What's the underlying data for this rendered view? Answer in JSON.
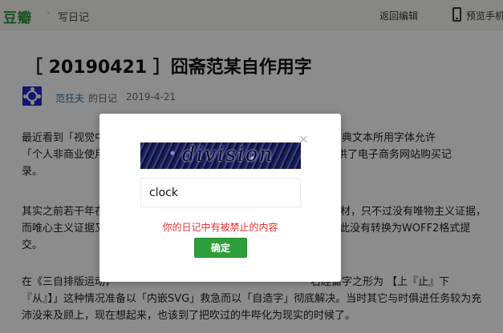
{
  "header": {
    "logo": "豆瓣",
    "separator": "·",
    "title": "写日记",
    "back_label": "返回编辑",
    "preview_label": "预览手机"
  },
  "article": {
    "title": "［ 20190421 ］囧斋范某自作用字",
    "author": "范狂夫",
    "diary_label": "的日记",
    "date": "2019-4-21",
    "paragraphs": [
      [
        "最近看到「视觉中",
        "",
        "附上。古典文本所用字体允许"
      ],
      [
        "「个人非商业使用",
        "",
        "字体则提供了电子商务网站购买记"
      ],
      [
        "录。"
      ],
      [
        "其实之前若干年在",
        "",
        "素材，只不过没有唯物主义证据，"
      ],
      [
        "而唯心主义证据又",
        "",
        "因此没有转换为WOFF2格式提"
      ],
      [
        "交。"
      ],
      [
        "在《三自排版运动，",
        "",
        "右經龠字之形为 【上『止』下"
      ],
      [
        "『从』】」这种情况准备以「内嵌SVG」救急而以「自造字」彻底解决。当时其它与时俱进任务较为充"
      ],
      [
        "沛没来及顾上，现在想起来，也该到了把吹过的牛哔化为现实的时候了。"
      ]
    ]
  },
  "dialog": {
    "captcha_text": "division",
    "input_value": "clock",
    "error": "你的日记中有被禁止的内容",
    "confirm_label": "确定",
    "close_glyph": "×"
  },
  "colors": {
    "brand": "#2e963d",
    "error": "#e5302f",
    "button": "#2e9e3a",
    "link": "#3377aa"
  }
}
